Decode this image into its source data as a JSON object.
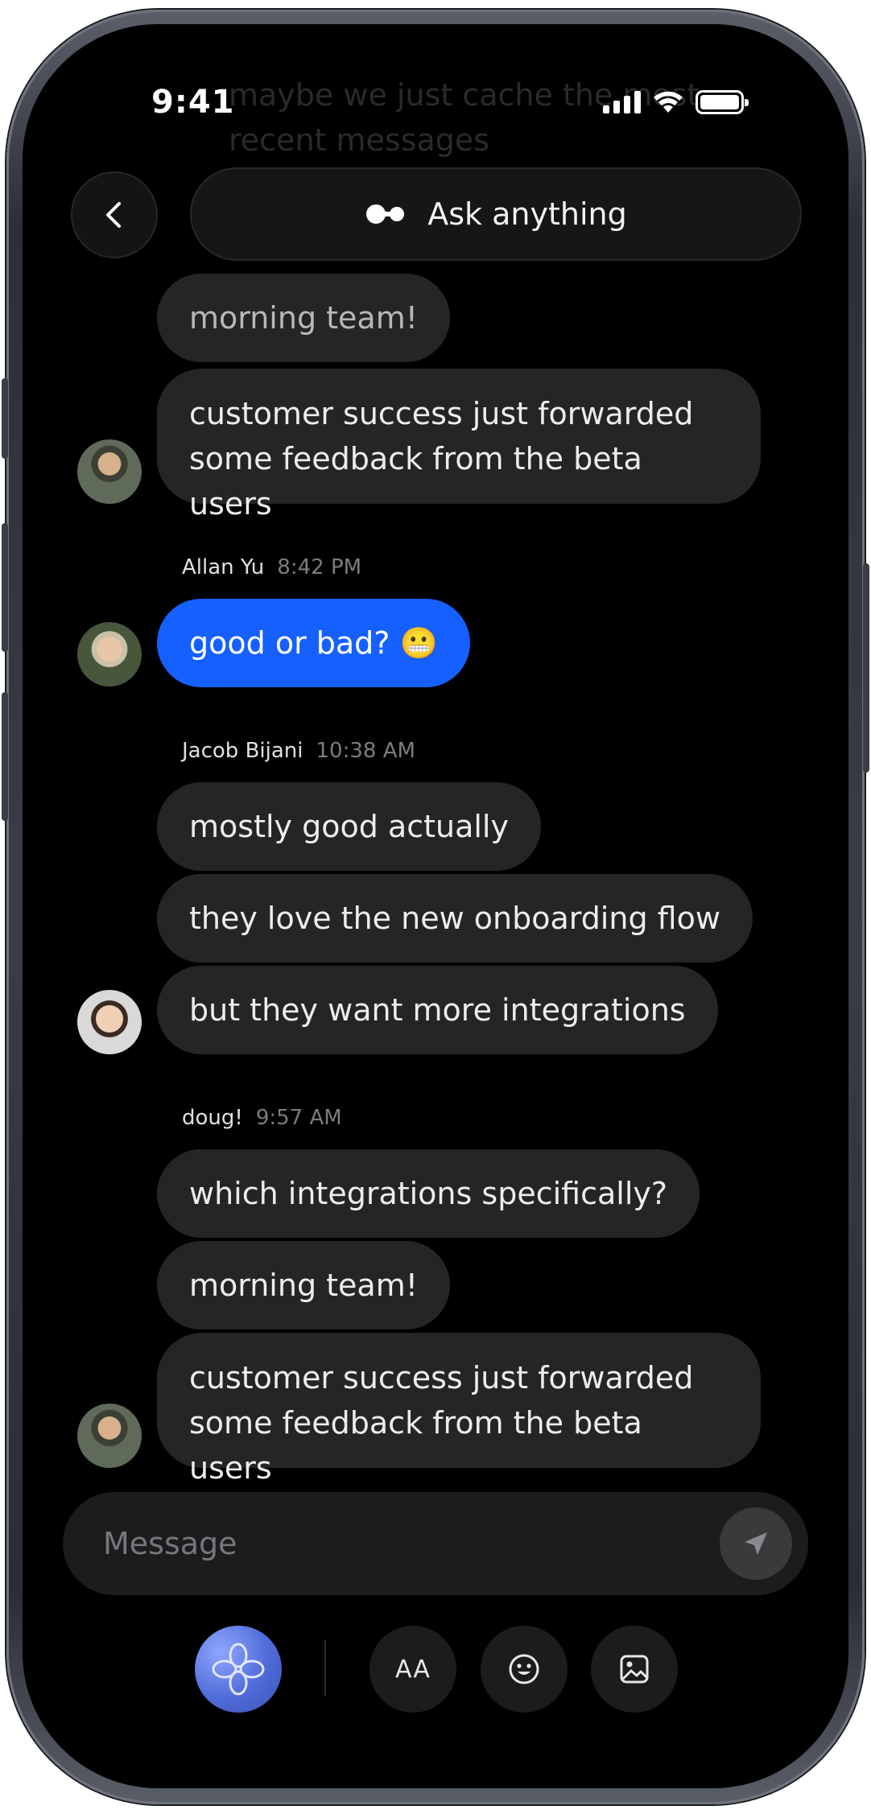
{
  "status_bar": {
    "time": "9:41"
  },
  "header": {
    "ask_placeholder": "Ask anything",
    "ghost_text": "maybe we just cache the most recent messages"
  },
  "messages": {
    "m1": "morning team!",
    "m2": "customer success just forwarded some feedback from the beta users",
    "group_allan": {
      "author": "Allan Yu",
      "time": "8:42 PM"
    },
    "m3": "good or bad? 😬",
    "group_jacob": {
      "author": "Jacob Bijani",
      "time": "10:38 AM"
    },
    "m4": "mostly good actually",
    "m5": "they love the new onboarding flow",
    "m6": "but they want more integrations",
    "group_doug": {
      "author": "doug!",
      "time": "9:57 AM"
    },
    "m7": "which integrations specifically?",
    "m8": "morning team!",
    "m9": "customer success just forwarded some feedback from the beta users"
  },
  "composer": {
    "placeholder": "Message"
  },
  "toolbar": {
    "font_label": "AA"
  },
  "colors": {
    "accent": "#1560ff",
    "bubble": "#252527",
    "background": "#000000"
  }
}
